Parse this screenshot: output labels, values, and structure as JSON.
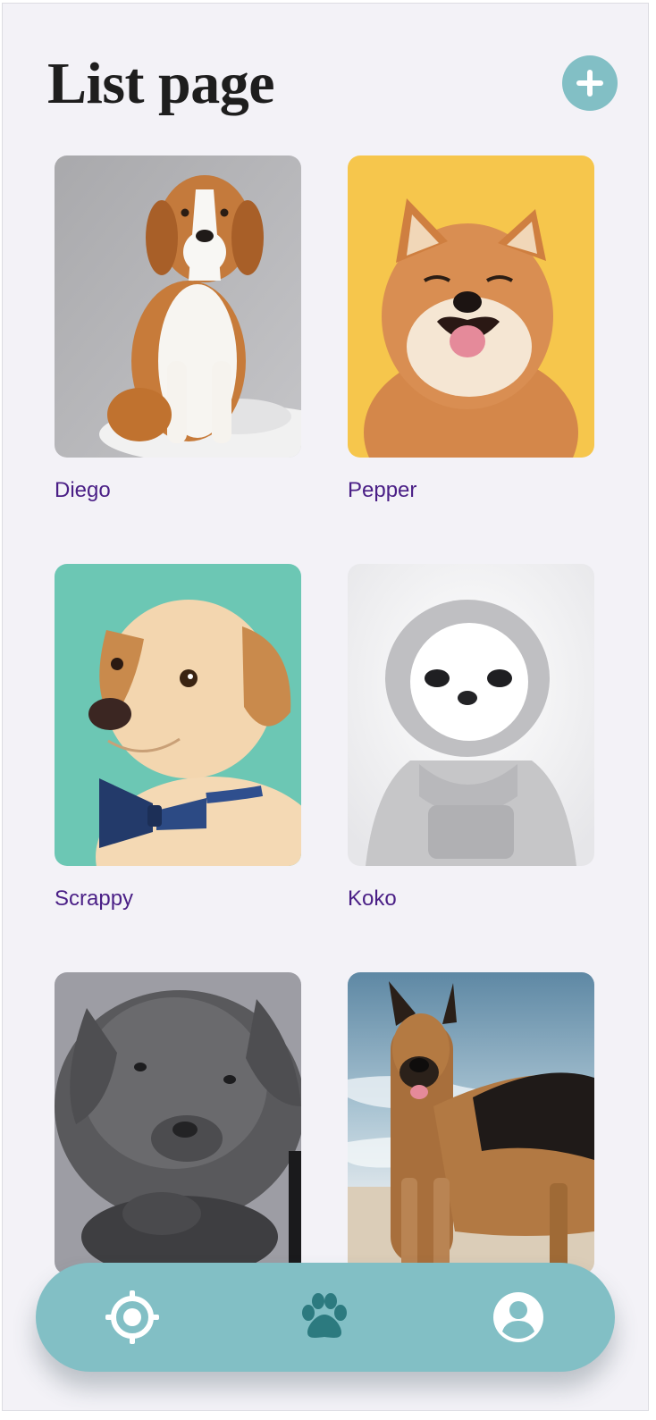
{
  "header": {
    "title": "List page",
    "add_icon": "plus-icon"
  },
  "colors": {
    "accent": "#82bfc5",
    "pet_name": "#4a1f86",
    "paw_active": "#2c7a7f",
    "background": "#f3f2f7"
  },
  "pets": [
    {
      "name": "Diego",
      "photo": "beagle sitting on white stool",
      "background": "#b4b4b6"
    },
    {
      "name": "Pepper",
      "photo": "smiling shiba inu",
      "background": "#f6c64c"
    },
    {
      "name": "Scrappy",
      "photo": "cream puppy with blue bow tie",
      "background": "#6cc7b4"
    },
    {
      "name": "Koko",
      "photo": "chihuahua in grey hoodie",
      "background": "#eeeef0"
    },
    {
      "name": "",
      "photo": "grey mastiff puppy",
      "background": "#9d9da4"
    },
    {
      "name": "",
      "photo": "german shepherd on beach",
      "background": "#7fa9bd"
    }
  ],
  "nav": [
    {
      "icon": "locate-icon"
    },
    {
      "icon": "paw-icon"
    },
    {
      "icon": "account-icon"
    }
  ]
}
